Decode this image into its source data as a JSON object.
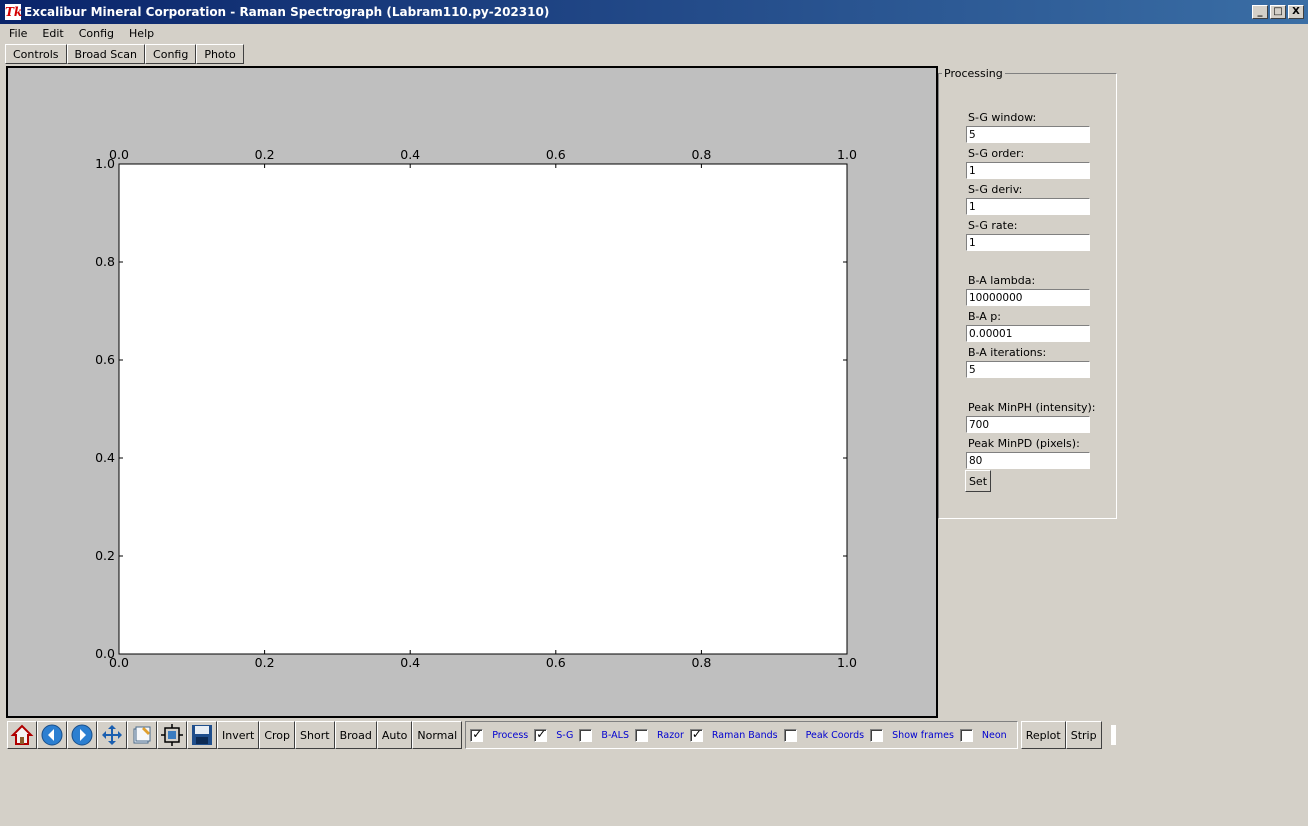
{
  "window": {
    "title": "Excalibur Mineral Corporation - Raman Spectrograph (Labram110.py-202310)",
    "icon": "tk-feather-icon",
    "logo_text": "Tk",
    "buttons": [
      "_",
      "□",
      "X"
    ]
  },
  "menu": [
    "File",
    "Edit",
    "Config",
    "Help"
  ],
  "tabs": [
    "Controls",
    "Broad Scan",
    "Config",
    "Photo"
  ],
  "plot": {
    "x_ticks": [
      "0.0",
      "0.2",
      "0.4",
      "0.6",
      "0.8",
      "1.0"
    ],
    "y_ticks": [
      "0.0",
      "0.2",
      "0.4",
      "0.6",
      "0.8",
      "1.0"
    ],
    "x_ticks_top": [
      "0.0",
      "0.2",
      "0.4",
      "0.6",
      "0.8",
      "1.0"
    ]
  },
  "processing": {
    "title": "Processing",
    "fields": [
      {
        "label": "S-G window:",
        "value": "5"
      },
      {
        "label": "S-G order:",
        "value": "1"
      },
      {
        "label": "S-G deriv:",
        "value": "1"
      },
      {
        "label": "S-G rate:",
        "value": "1"
      },
      {
        "label": "B-A lambda:",
        "value": "10000000"
      },
      {
        "label": "B-A p:",
        "value": "0.00001"
      },
      {
        "label": "B-A iterations:",
        "value": "5"
      },
      {
        "label": "Peak MinPH (intensity):",
        "value": "700"
      },
      {
        "label": "Peak MinPD (pixels):",
        "value": "80"
      }
    ],
    "set_label": "Set"
  },
  "toolbar": {
    "icons": [
      "home-icon",
      "back-icon",
      "forward-icon",
      "pan-icon",
      "subplots-icon",
      "configure-icon",
      "save-icon"
    ],
    "buttons": [
      "Invert",
      "Crop",
      "Short",
      "Broad",
      "Auto",
      "Normal"
    ],
    "checks": [
      {
        "label": "Process",
        "checked": true
      },
      {
        "label": "S-G",
        "checked": true
      },
      {
        "label": "B-ALS",
        "checked": false
      },
      {
        "label": "Razor",
        "checked": false
      },
      {
        "label": "Raman Bands",
        "checked": true
      },
      {
        "label": "Peak Coords",
        "checked": false
      },
      {
        "label": "Show frames",
        "checked": false
      },
      {
        "label": "Neon",
        "checked": false
      }
    ],
    "right_buttons": [
      "Replot",
      "Strip"
    ]
  }
}
